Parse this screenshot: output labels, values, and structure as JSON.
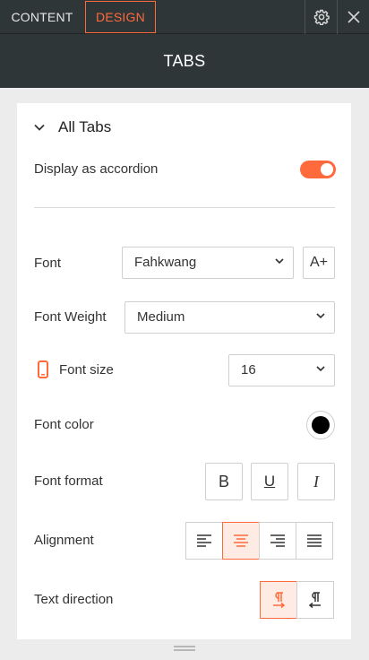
{
  "tabs": {
    "content_label": "CONTENT",
    "design_label": "DESIGN"
  },
  "header": {
    "title": "TABS"
  },
  "section": {
    "title": "All Tabs"
  },
  "accordion": {
    "label": "Display as accordion",
    "enabled": true
  },
  "font": {
    "label": "Font",
    "value": "Fahkwang",
    "add_font_label": "A+"
  },
  "font_weight": {
    "label": "Font Weight",
    "value": "Medium"
  },
  "font_size": {
    "label": "Font size",
    "value": "16"
  },
  "font_color": {
    "label": "Font color",
    "value": "#000000"
  },
  "font_format": {
    "label": "Font format",
    "bold": "B",
    "underline": "U",
    "italic": "I"
  },
  "alignment": {
    "label": "Alignment",
    "selected": "center"
  },
  "text_direction": {
    "label": "Text direction",
    "selected": "ltr"
  },
  "colors": {
    "accent": "#ff6a3d",
    "header_bg": "#2f3638",
    "panel_bg": "#ececec"
  },
  "icons": {
    "settings": "gear-icon",
    "close": "close-icon",
    "device": "mobile-icon"
  }
}
